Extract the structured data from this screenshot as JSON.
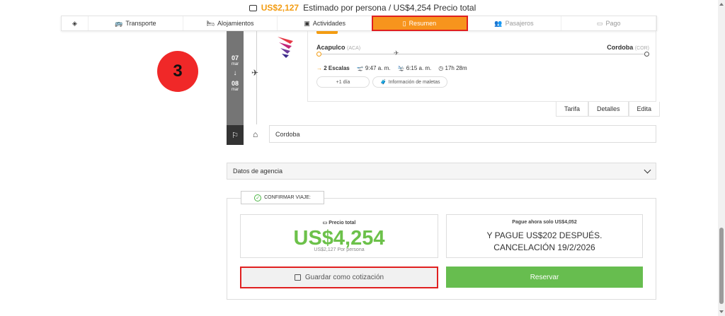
{
  "topbar": {
    "price_pp": "US$2,127",
    "estimate_text": "Estimado por persona / US$4,254 Precio total"
  },
  "stepper": {
    "home_icon": "heart-diamond-icon",
    "steps": [
      {
        "label": "Transporte",
        "icon": "bus-icon"
      },
      {
        "label": "Alojamientos",
        "icon": "bed-icon"
      },
      {
        "label": "Actividades",
        "icon": "ticket-icon"
      },
      {
        "label": "Resumen",
        "icon": "document-icon"
      },
      {
        "label": "Pasajeros",
        "icon": "people-icon"
      },
      {
        "label": "Pago",
        "icon": "card-icon"
      }
    ]
  },
  "badge": {
    "number": "3"
  },
  "timeline": {
    "start_day": "07",
    "start_month": "mar",
    "arrow": "↓",
    "end_day": "08",
    "end_month": "mar"
  },
  "flight": {
    "origin_city": "Acapulco",
    "origin_code": "(ACA)",
    "dest_city": "Cordoba",
    "dest_code": "(COR)",
    "stops": "2 Escalas",
    "depart_time": "9:47 a. m.",
    "arrive_time": "6:15 a. m.",
    "duration": "17h 28m",
    "plus_day": "+1 día",
    "baggage": "Información de maletas",
    "tabs": [
      "Tarifa",
      "Detalles",
      "Edita"
    ]
  },
  "destination": {
    "name": "Cordoba"
  },
  "agency": {
    "label": "Datos de agencia"
  },
  "confirm": {
    "tag": "CONFIRMAR VIAJE:",
    "total_label": "Precio total",
    "total_value": "US$4,254",
    "per_person": "US$2,127 Por persona",
    "pay_now": "Pague ahora solo US$4,052",
    "pay_line1": "Y PAGUE US$202 DESPUÉS.",
    "pay_line2": "CANCELACIÓN 19/2/2026",
    "save_label": "Guardar como cotización",
    "reserve_label": "Reservar"
  },
  "colors": {
    "accent": "#f7941d",
    "highlight": "#e02020",
    "green": "#67bd4f",
    "badge": "#f02828"
  }
}
